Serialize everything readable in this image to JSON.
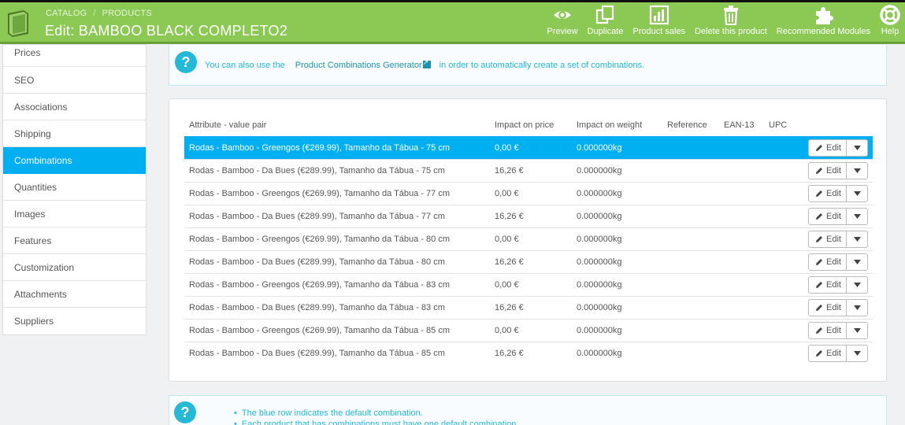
{
  "header": {
    "breadcrumb": [
      "CATALOG",
      "PRODUCTS"
    ],
    "breadcrumb_sep": "/",
    "title": "Edit: BAMBOO BLACK COMPLETO2",
    "toolbar": [
      {
        "label": "Preview",
        "icon": "eye-icon"
      },
      {
        "label": "Duplicate",
        "icon": "copy-icon"
      },
      {
        "label": "Product sales",
        "icon": "chart-icon"
      },
      {
        "label": "Delete this product",
        "icon": "trash-icon"
      },
      {
        "label": "Recommended Modules",
        "icon": "puzzle-icon"
      },
      {
        "label": "Help",
        "icon": "lifebuoy-icon"
      }
    ]
  },
  "sidebar": {
    "items": [
      {
        "label": "Prices"
      },
      {
        "label": "SEO"
      },
      {
        "label": "Associations"
      },
      {
        "label": "Shipping"
      },
      {
        "label": "Combinations",
        "active": true
      },
      {
        "label": "Quantities"
      },
      {
        "label": "Images"
      },
      {
        "label": "Features"
      },
      {
        "label": "Customization"
      },
      {
        "label": "Attachments"
      },
      {
        "label": "Suppliers"
      }
    ]
  },
  "info": {
    "prefix": "You can also use the",
    "link": "Product Combinations Generator",
    "suffix": "in order to automatically create a set of combinations."
  },
  "table": {
    "columns": [
      "Attribute - value pair",
      "Impact on price",
      "Impact on weight",
      "Reference",
      "EAN-13",
      "UPC"
    ],
    "edit_label": "Edit",
    "rows": [
      {
        "attr": "Rodas - Bamboo - Greengos (€269.99), Tamanho da Tábua - 75 cm",
        "price": "0,00 €",
        "weight": "0.000000kg",
        "default": true
      },
      {
        "attr": "Rodas - Bamboo - Da Bues (€289.99), Tamanho da Tábua - 75 cm",
        "price": "16,26 €",
        "weight": "0.000000kg"
      },
      {
        "attr": "Rodas - Bamboo - Greengos (€269.99), Tamanho da Tábua - 77 cm",
        "price": "0,00 €",
        "weight": "0.000000kg"
      },
      {
        "attr": "Rodas - Bamboo - Da Bues (€289.99), Tamanho da Tábua - 77 cm",
        "price": "16,26 €",
        "weight": "0.000000kg"
      },
      {
        "attr": "Rodas - Bamboo - Greengos (€269.99), Tamanho da Tábua - 80 cm",
        "price": "0,00 €",
        "weight": "0.000000kg"
      },
      {
        "attr": "Rodas - Bamboo - Da Bues (€289.99), Tamanho da Tábua - 80 cm",
        "price": "16,26 €",
        "weight": "0.000000kg"
      },
      {
        "attr": "Rodas - Bamboo - Greengos (€269.99), Tamanho da Tábua - 83 cm",
        "price": "0,00 €",
        "weight": "0.000000kg"
      },
      {
        "attr": "Rodas - Bamboo - Da Bues (€289.99), Tamanho da Tábua - 83 cm",
        "price": "16,26 €",
        "weight": "0.000000kg"
      },
      {
        "attr": "Rodas - Bamboo - Greengos (€269.99), Tamanho da Tábua - 85 cm",
        "price": "0,00 €",
        "weight": "0.000000kg"
      },
      {
        "attr": "Rodas - Bamboo - Da Bues (€289.99), Tamanho da Tábua - 85 cm",
        "price": "16,26 €",
        "weight": "0.000000kg"
      }
    ]
  },
  "notes": [
    "The blue row indicates the default combination.",
    "Each product that has combinations must have one default combination."
  ],
  "colors": {
    "header": "#8bc954",
    "active": "#00aff0",
    "info_text": "#25b9d7"
  }
}
